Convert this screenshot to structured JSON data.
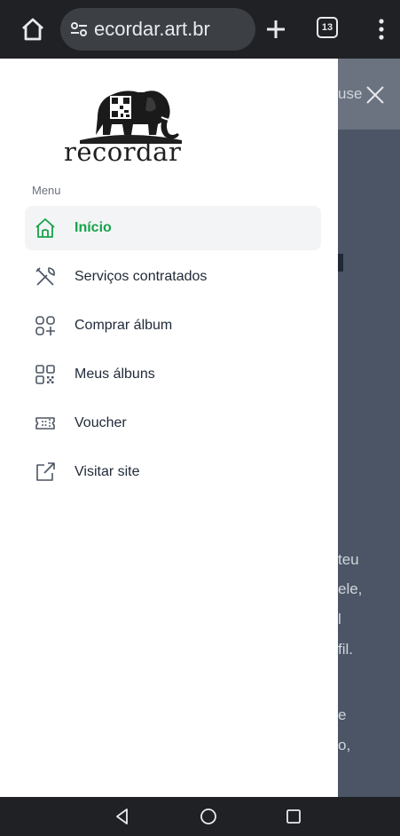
{
  "browser": {
    "url": "ecordar.art.br",
    "tab_count": "13"
  },
  "background_page": {
    "header_fragment": "use",
    "text_fragments": [
      "teu",
      "ele,",
      "l",
      "fil.",
      "e",
      "o,"
    ]
  },
  "drawer": {
    "logo_text": "recordar",
    "menu_heading": "Menu",
    "items": [
      {
        "label": "Início",
        "icon": "home-icon",
        "active": true
      },
      {
        "label": "Serviços contratados",
        "icon": "tools-icon",
        "active": false
      },
      {
        "label": "Comprar álbum",
        "icon": "add-grid-icon",
        "active": false
      },
      {
        "label": "Meus álbuns",
        "icon": "qr-code-icon",
        "active": false
      },
      {
        "label": "Voucher",
        "icon": "ticket-icon",
        "active": false
      },
      {
        "label": "Visitar site",
        "icon": "external-link-icon",
        "active": false
      }
    ]
  },
  "colors": {
    "accent_green": "#16a34a",
    "browser_bar": "#202124",
    "overlay": "#4b5566"
  }
}
